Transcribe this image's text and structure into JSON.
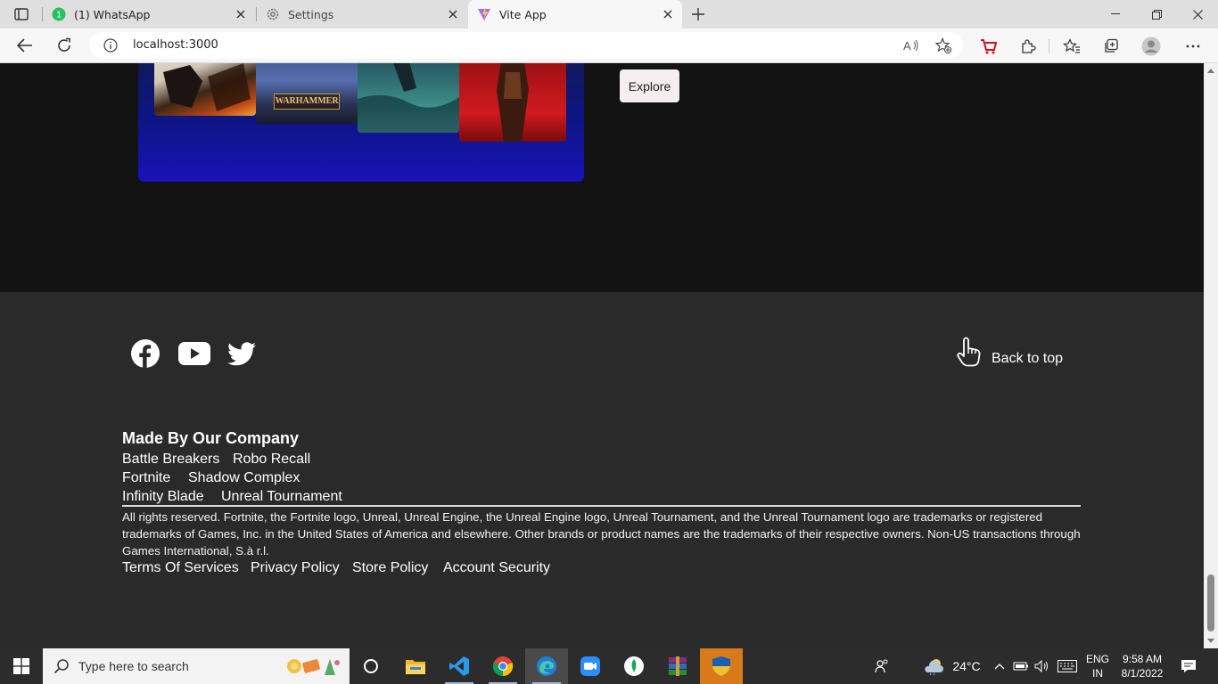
{
  "browser": {
    "tabs": [
      {
        "title": "(1) WhatsApp",
        "badge": "1"
      },
      {
        "title": "Settings"
      },
      {
        "title": "Vite App"
      }
    ],
    "url": "localhost:3000"
  },
  "banner": {
    "art_caption": "WARHAMMER",
    "explore_label": "Explore"
  },
  "footer": {
    "social": [
      "facebook-icon",
      "youtube-icon",
      "twitter-icon"
    ],
    "back_to_top": "Back to top",
    "made_by": "Made By Our Company",
    "games": [
      [
        "Battle Breakers",
        "Robo Recall"
      ],
      [
        "Fortnite",
        "Shadow Complex"
      ],
      [
        "Infinity Blade",
        "Unreal Tournament"
      ]
    ],
    "legal": "All rights reserved. Fortnite, the Fortnite logo, Unreal, Unreal Engine, the Unreal Engine logo, Unreal Tournament, and the Unreal Tournament logo are trademarks or registered trademarks of Games, Inc. in the United States of America and elsewhere. Other brands or product names are the trademarks of their respective owners. Non-US transactions through Games International, S.à r.l.",
    "policies": [
      "Terms Of Services",
      "Privacy Policy",
      "Store Policy",
      "Account Security"
    ]
  },
  "taskbar": {
    "search_placeholder": "Type here to search",
    "weather": "24°C",
    "lang": [
      "ENG",
      "IN"
    ],
    "time": "9:58 AM",
    "date": "8/1/2022"
  },
  "colors": {
    "page_bg": "#121212",
    "footer_bg": "#2a2a2a",
    "accent_banner": "#0c1585"
  }
}
